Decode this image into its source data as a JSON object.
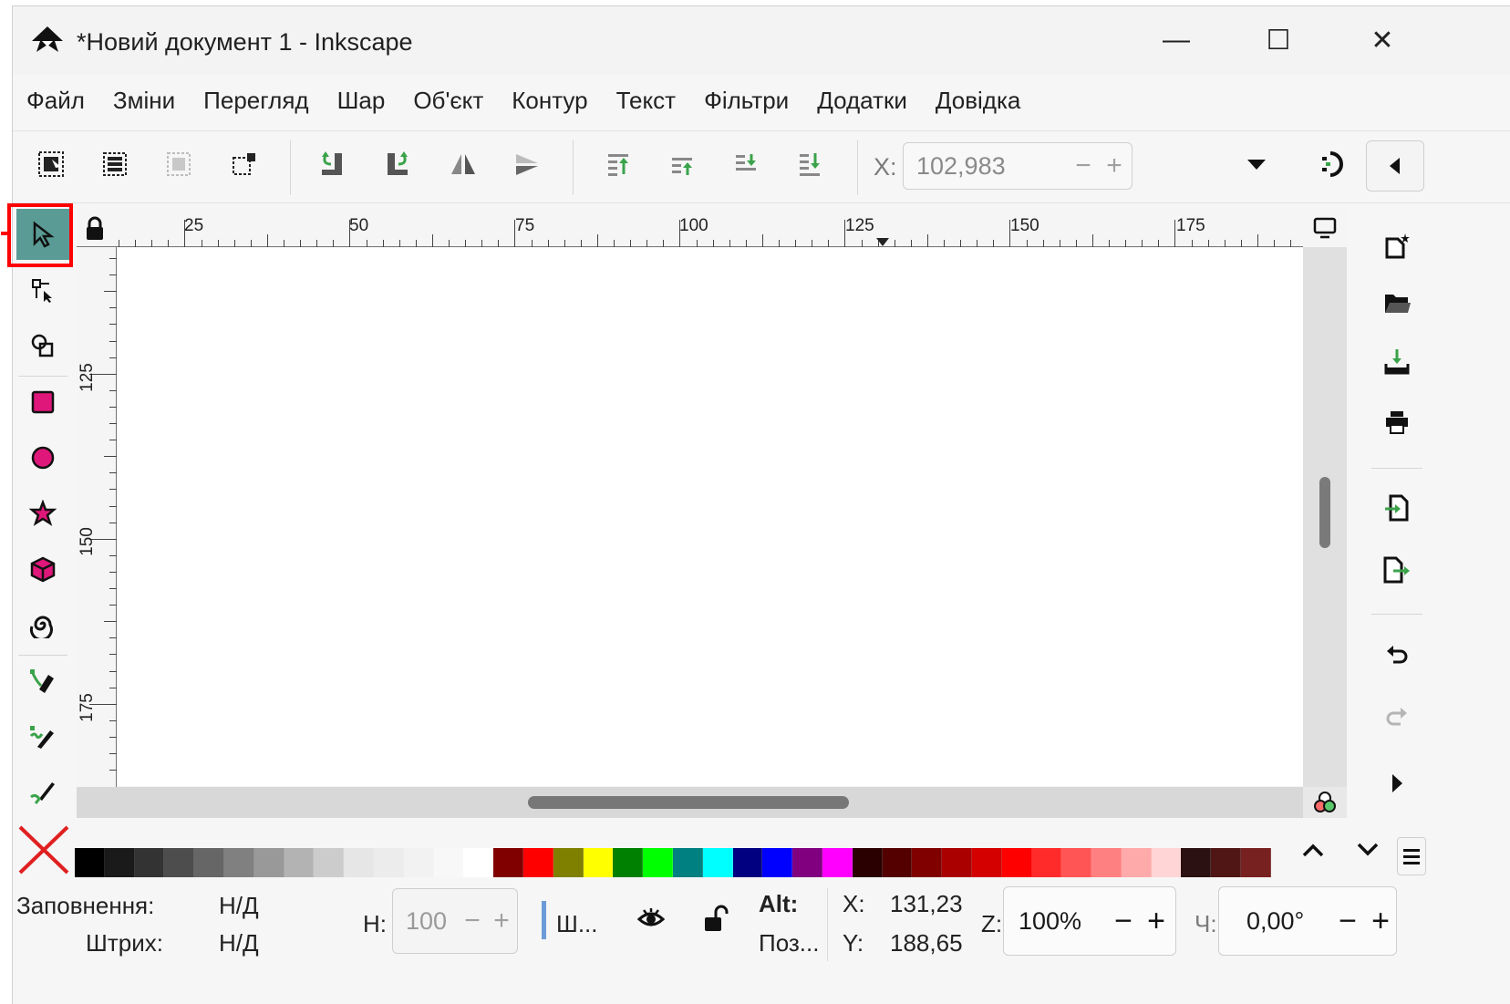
{
  "window": {
    "title": "*Новий документ 1 - Inkscape",
    "controls": {
      "minimize": "—",
      "maximize": "☐",
      "close": "✕"
    }
  },
  "menu": [
    "Файл",
    "Зміни",
    "Перегляд",
    "Шар",
    "Об'єкт",
    "Контур",
    "Текст",
    "Фільтри",
    "Додатки",
    "Довідка"
  ],
  "commandbar": {
    "x_label": "X:",
    "x_value": "102,983",
    "buttons": [
      "select-all-icon",
      "select-all-layers-icon",
      "deselect-icon",
      "select-same-icon",
      "rotate-ccw-icon",
      "rotate-cw-icon",
      "flip-horizontal-icon",
      "flip-vertical-icon",
      "raise-to-top-icon",
      "raise-icon",
      "lower-icon",
      "lower-to-bottom-icon"
    ]
  },
  "tools": [
    "selector",
    "node",
    "tweak",
    "rectangle",
    "ellipse",
    "star",
    "3dbox",
    "spiral",
    "pen",
    "pencil",
    "calligraphy"
  ],
  "active_tool": "selector",
  "ruler": {
    "top_labels": [
      "25",
      "50",
      "75",
      "100",
      "125",
      "150",
      "175"
    ],
    "left_labels": [
      "125",
      "150",
      "175"
    ]
  },
  "right_commands": [
    "new-document-icon",
    "open-icon",
    "save-icon",
    "print-icon",
    "import-icon",
    "export-icon",
    "undo-icon",
    "redo-icon",
    "more-icon"
  ],
  "palette": {
    "colors": [
      "#000000",
      "#1a1a1a",
      "#333333",
      "#4d4d4d",
      "#666666",
      "#808080",
      "#999999",
      "#b3b3b3",
      "#cccccc",
      "#e6e6e6",
      "#ececec",
      "#f2f2f2",
      "#f8f8f8",
      "#ffffff",
      "#800000",
      "#ff0000",
      "#808000",
      "#ffff00",
      "#008000",
      "#00ff00",
      "#008080",
      "#00ffff",
      "#000080",
      "#0000ff",
      "#800080",
      "#ff00ff",
      "#2b0000",
      "#550000",
      "#800000",
      "#aa0000",
      "#d40000",
      "#ff0000",
      "#ff2a2a",
      "#ff5555",
      "#ff8080",
      "#ffaaaa",
      "#ffd5d5",
      "#2b1111",
      "#501616",
      "#782121"
    ]
  },
  "status": {
    "fill_label": "Заповнення:",
    "fill_value": "Н/Д",
    "stroke_label": "Штрих:",
    "stroke_value": "Н/Д",
    "h_label": "Н:",
    "h_value": "100",
    "layer_short": "Ш...",
    "alt_label": "Alt:",
    "position_short": "Поз...",
    "x_label": "X:",
    "x_value": "131,23",
    "y_label": "Y:",
    "y_value": "188,65",
    "zoom_label": "Z:",
    "zoom_value": "100%",
    "rotate_label": "Ч:",
    "rotate_value": "0,00°"
  },
  "colors": {
    "accent_active_tool": "#5a9c95",
    "highlight_box": "#ff0000"
  }
}
